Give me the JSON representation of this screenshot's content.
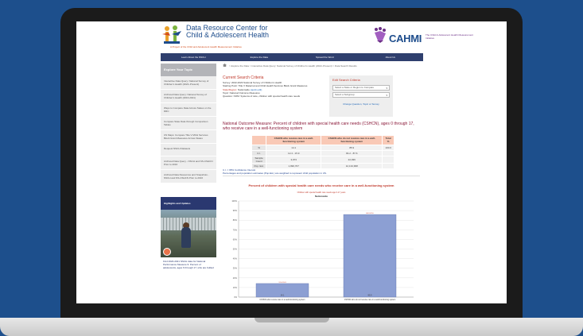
{
  "site": {
    "title_line1": "Data Resource Center for",
    "title_line2": "Child & Adolescent Health",
    "subtitle": "A Project of the Child and Adolescent Health Measurement Initiative",
    "cahmi_word": "CAHMI",
    "cahmi_sub": "The Child & Adolescent Health Measurement Initiative"
  },
  "nav": [
    "Learn About the NSCH",
    "Explore the Data",
    "Spread the Word",
    "About Us"
  ],
  "sidebar": {
    "heading": "Explore Your Topic",
    "items": [
      "Interactive Data Query: National Survey of Children's Health (2022–Present)",
      "Archived Data Query: National Survey of Children's Health (2016-2021)",
      "Ways to Compare Data Across States on the DRC",
      "Compare State Data through Comparison Tables",
      "US Maps: Compare Title V MCH Services Block Grant Measures Across States",
      "Request NSCH Datasets",
      "Archived Data Query - NSCH and NS-CSHCN Prior to 2016",
      "Archived Data Resources and Snapshots - NSCH and NS-CSHCN Prior to 2016"
    ],
    "highlights_heading": "Highlights and Updates",
    "highlights_text": "Find 2020-2021 NSCH data for National Performance Measure 9: Percent of adolescents, ages 6 through 17, who are bullied"
  },
  "breadcrumb": "> Explore the Data > Interactive Data Query: National Survey of Children's Health (2022–Present) > Data Search Results",
  "criteria": {
    "title": "Current Search Criteria",
    "survey": "Survey: 2022-2023 National Survey of Children's Health",
    "starting": "Starting Point: Title V Maternal and Child Health Services Block Grant Measures",
    "state_key": "State/Region:",
    "state_val": "Nationwide",
    "quick_edit": "(quick edit)",
    "topic": "Topic: National Outcome Measures",
    "question": "Question: NOM: Systems of care, children with special health care needs"
  },
  "edit": {
    "title": "Edit Search Criteria",
    "select_state": "Select a State or Region to Compare",
    "select_subgroup": "Select a Subgroup",
    "change_link": "Change Question, Topic or Survey"
  },
  "measure_title": "National Outcome Measure: Percent of children with special health care needs (CSHCN), ages 0 through 17, who receive care in a well-functioning system",
  "table": {
    "headers": [
      "",
      "CSHCN who receive care in a well-functioning system",
      "CSHCN who do not receive care in a well-functioning system",
      "Total %"
    ],
    "rows": [
      [
        "%",
        "14.1",
        "85.9",
        "100.0"
      ],
      [
        "C.I.",
        "12.4 - 15.9",
        "84.2 - 87.6",
        ""
      ],
      [
        "Sample Count",
        "3,973",
        "22,939",
        ""
      ],
      [
        "Pop. Est.",
        "1,990,707",
        "12,134,998",
        ""
      ]
    ]
  },
  "notes": {
    "ci": "C.I. = 95% Confidence Interval.",
    "weighted": "Percentages and population estimates (Pop.Est.) are weighted to represent child population in US."
  },
  "chart_data": {
    "type": "bar",
    "title": "Percent of children with special health care needs who receive care in a well-functioning system",
    "subtitle": "Children with special health care needs age 0-17 years",
    "legend": "Nationwide",
    "categories": [
      "CSHCN who receive care in a well-functioning system",
      "CSHCN who do not receive care in a well-functioning system"
    ],
    "values": [
      14.1,
      85.9
    ],
    "ci_labels": [
      "12.4-15.9",
      "84.2-87.6"
    ],
    "value_labels": [
      "14.1",
      "85.9"
    ],
    "yticks": [
      "100%",
      "90%",
      "80%",
      "70%",
      "60%",
      "50%",
      "40%",
      "30%",
      "20%",
      "10%",
      "0%"
    ],
    "ylim": [
      0,
      100
    ],
    "bar_color": "#8c9fd3"
  }
}
